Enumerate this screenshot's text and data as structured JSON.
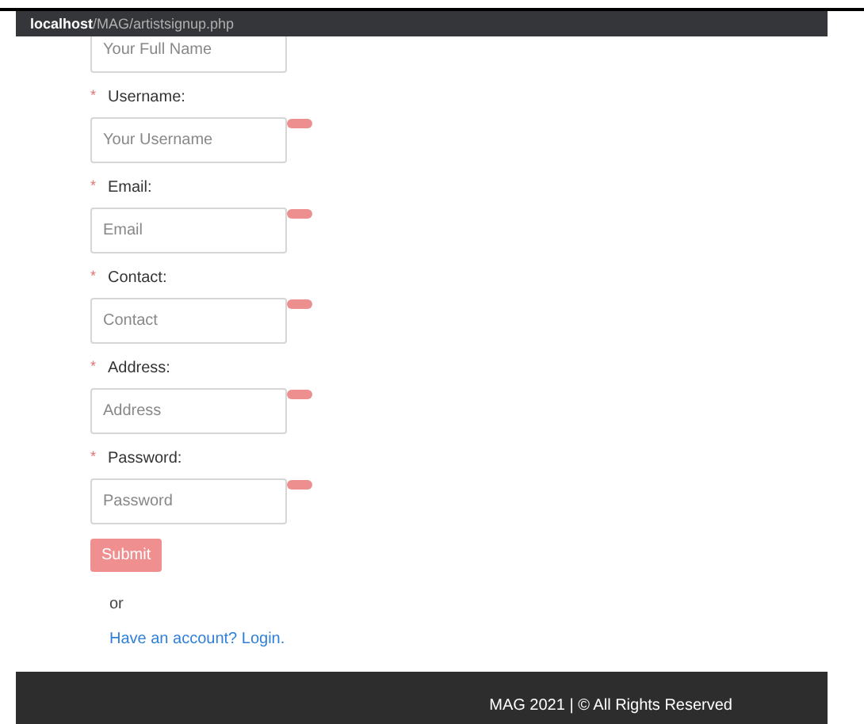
{
  "address_bar": {
    "host": "localhost",
    "path": "/MAG/artistsignup.php"
  },
  "fields": [
    {
      "placeholder": "Your Full Name"
    },
    {
      "marker": "*",
      "label": "Username:",
      "placeholder": "Your Username"
    },
    {
      "marker": "*",
      "label": "Email:",
      "placeholder": "Email"
    },
    {
      "marker": "*",
      "label": "Contact:",
      "placeholder": "Contact"
    },
    {
      "marker": "*",
      "label": "Address:",
      "placeholder": "Address"
    },
    {
      "marker": "*",
      "label": "Password:",
      "placeholder": "Password"
    }
  ],
  "submit": "Submit",
  "separator": "or",
  "login_link": "Have an account? Login.",
  "footer": "MAG 2021 | © All Rights Reserved"
}
